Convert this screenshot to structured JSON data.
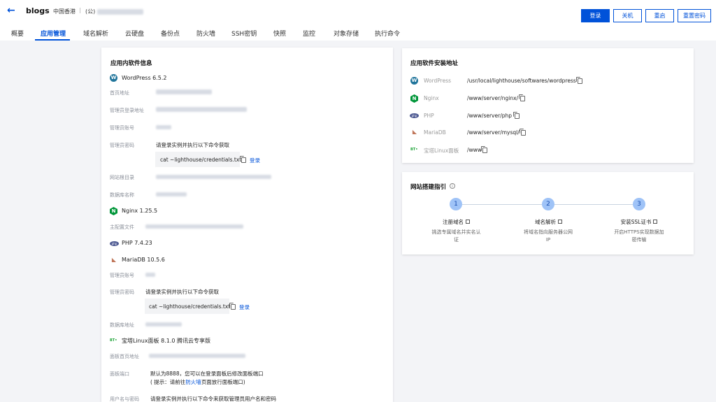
{
  "header": {
    "title": "blogs",
    "region": "中国香港",
    "separator": "|",
    "ip_label": "(公)",
    "buttons": {
      "login": "登录",
      "shutdown": "关机",
      "restart": "重启",
      "reset_password": "重置密码"
    },
    "colors": {
      "accent": "#0052d9"
    }
  },
  "tabs": [
    {
      "label": "概要"
    },
    {
      "label": "应用管理",
      "active": true
    },
    {
      "label": "域名解析"
    },
    {
      "label": "云硬盘"
    },
    {
      "label": "备份点"
    },
    {
      "label": "防火墙"
    },
    {
      "label": "SSH密钥"
    },
    {
      "label": "快照"
    },
    {
      "label": "监控"
    },
    {
      "label": "对象存储"
    },
    {
      "label": "执行命令"
    }
  ],
  "software_info": {
    "title": "应用内软件信息",
    "wordpress": {
      "name": "WordPress 6.5.2",
      "home_label": "首页地址",
      "admin_url_label": "管理员登录地址",
      "admin_account_label": "管理员账号",
      "admin_password_label": "管理员密码",
      "password_hint": "请登录实例并执行以下命令获取",
      "command": "cat ~lighthouse/credentials.txt",
      "login_link": "登录",
      "site_root_label": "网站根目录",
      "db_name_label": "数据库名称"
    },
    "nginx": {
      "name": "Nginx 1.25.5",
      "config_label": "主配置文件"
    },
    "php": {
      "name": "PHP 7.4.23"
    },
    "mariadb": {
      "name": "MariaDB 10.5.6",
      "admin_account_label": "管理员账号",
      "admin_password_label": "管理员密码",
      "password_hint": "请登录实例并执行以下命令获取",
      "command": "cat ~lighthouse/credentials.txt",
      "login_link": "登录",
      "db_address_label": "数据库地址"
    },
    "bt": {
      "name": "宝塔Linux面板 8.1.0 腾讯云专享版",
      "home_label": "面板首页地址",
      "port_label": "面板端口",
      "port_text": "默认为8888，您可以在登录面板后修改面板端口",
      "port_hint_prefix": "( 提示：请前往",
      "port_hint_link": "防火墙",
      "port_hint_suffix": "页面放行面板端口)",
      "user_label": "用户名与密码",
      "user_text": "请登录实例并执行以下命令来获取管理员用户名和密码"
    }
  },
  "install_paths": {
    "title": "应用软件安装地址",
    "rows": [
      {
        "name": "WordPress",
        "path": "/usr/local/lighthouse/softwares/wordpress",
        "icon": "wordpress-logo"
      },
      {
        "name": "Nginx",
        "path": "/www/server/nginx/",
        "icon": "nginx-logo"
      },
      {
        "name": "PHP",
        "path": "/www/server/php",
        "icon": "php-logo"
      },
      {
        "name": "MariaDB",
        "path": "/www/server/mysql/",
        "icon": "mariadb-logo"
      },
      {
        "name": "宝塔Linux面板",
        "path": "/www",
        "icon": "bt-logo"
      }
    ]
  },
  "guide": {
    "title": "网站搭建指引",
    "steps": [
      {
        "num": "1",
        "title": "注册域名",
        "desc": "挑选专属域名并实名认证"
      },
      {
        "num": "2",
        "title": "域名解析",
        "desc": "将域名指向服务器公网IP"
      },
      {
        "num": "3",
        "title": "安装SSL证书",
        "desc": "开启HTTPS实现数据加密传输"
      }
    ]
  },
  "logos": {
    "wp": "W",
    "nginx": "N",
    "php": "php",
    "mariadb": "◣",
    "bt": "BT•"
  }
}
